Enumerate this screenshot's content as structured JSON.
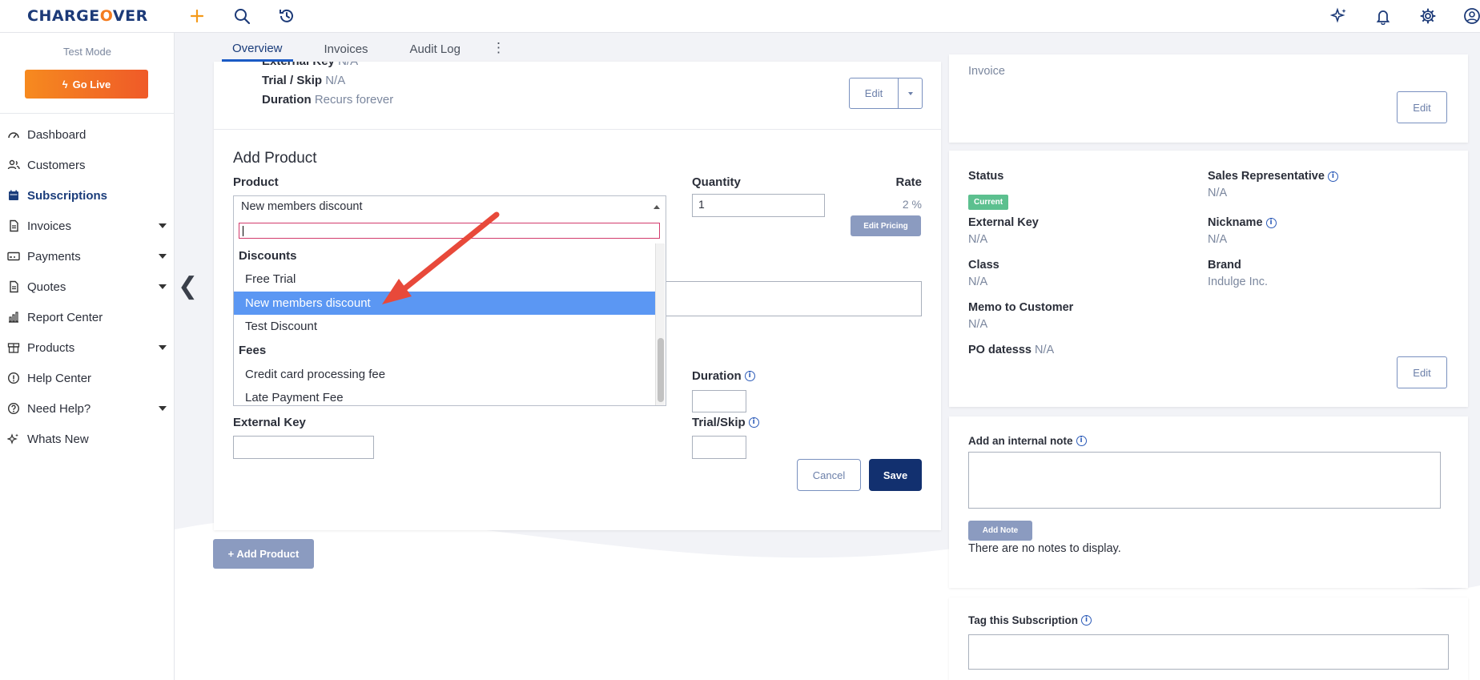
{
  "brand": {
    "logo_text_a": "CHARGE",
    "logo_text_o": "O",
    "logo_text_b": "VER"
  },
  "sidebar": {
    "mode_label": "Test Mode",
    "go_live_label": "Go Live",
    "items": [
      {
        "label": "Dashboard",
        "icon": "gauge-icon",
        "caret": false
      },
      {
        "label": "Customers",
        "icon": "users-icon",
        "caret": false
      },
      {
        "label": "Subscriptions",
        "icon": "calendar-icon",
        "caret": false,
        "active": true
      },
      {
        "label": "Invoices",
        "icon": "document-icon",
        "caret": true
      },
      {
        "label": "Payments",
        "icon": "card-icon",
        "caret": true
      },
      {
        "label": "Quotes",
        "icon": "document-icon",
        "caret": true
      },
      {
        "label": "Report Center",
        "icon": "chart-icon",
        "caret": false
      },
      {
        "label": "Products",
        "icon": "box-icon",
        "caret": true
      },
      {
        "label": "Help Center",
        "icon": "help-circle-icon",
        "caret": false
      },
      {
        "label": "Need Help?",
        "icon": "question-icon",
        "caret": true
      },
      {
        "label": "Whats New",
        "icon": "sparkle-icon",
        "caret": false
      }
    ]
  },
  "tabs": [
    {
      "label": "Overview",
      "active": true
    },
    {
      "label": "Invoices"
    },
    {
      "label": "Audit Log"
    }
  ],
  "tabs_more": "⋮",
  "summary": {
    "external_key_label": "External Key",
    "external_key_value": "N/A",
    "trial_label": "Trial / Skip",
    "trial_value": "N/A",
    "duration_label": "Duration",
    "duration_value": "Recurs forever",
    "edit_label": "Edit"
  },
  "add_product": {
    "heading": "Add Product",
    "product_label": "Product",
    "product_selected": "New members discount",
    "quantity_label": "Quantity",
    "quantity_value": "1",
    "rate_label": "Rate",
    "rate_value": "2 %",
    "edit_pricing_label": "Edit Pricing",
    "duration_label": "Duration",
    "external_key_label": "External Key",
    "trial_skip_label": "Trial/Skip",
    "cancel_label": "Cancel",
    "save_label": "Save"
  },
  "dropdown": {
    "search_value": "",
    "groups": [
      {
        "label": "Discounts",
        "options": [
          "Free Trial",
          "New members discount",
          "Test Discount"
        ]
      },
      {
        "label": "Fees",
        "options": [
          "Credit card processing fee",
          "Late Payment Fee"
        ]
      }
    ],
    "highlighted": "New members discount"
  },
  "add_product_button": "+ Add Product",
  "right": {
    "top_card": {
      "value": "Invoice",
      "edit_label": "Edit"
    },
    "details": {
      "status_label": "Status",
      "status_badge": "Current",
      "sales_rep_label": "Sales Representative",
      "sales_rep_value": "N/A",
      "external_key_label": "External Key",
      "external_key_value": "N/A",
      "nickname_label": "Nickname",
      "nickname_value": "N/A",
      "class_label": "Class",
      "class_value": "N/A",
      "brand_label": "Brand",
      "brand_value": "Indulge Inc.",
      "memo_label": "Memo to Customer",
      "memo_value": "N/A",
      "po_label": "PO datesss",
      "po_value": "N/A",
      "edit_label": "Edit"
    },
    "notes": {
      "label": "Add an internal note",
      "add_note_label": "Add Note",
      "empty_text": "There are no notes to display."
    },
    "tag": {
      "label": "Tag this Subscription"
    }
  },
  "colors": {
    "brand_navy": "#1c3a78",
    "brand_orange": "#f47c20",
    "highlight": "#5b97f3",
    "status_green": "#5cc08f",
    "arrow_red": "#e8493a"
  }
}
